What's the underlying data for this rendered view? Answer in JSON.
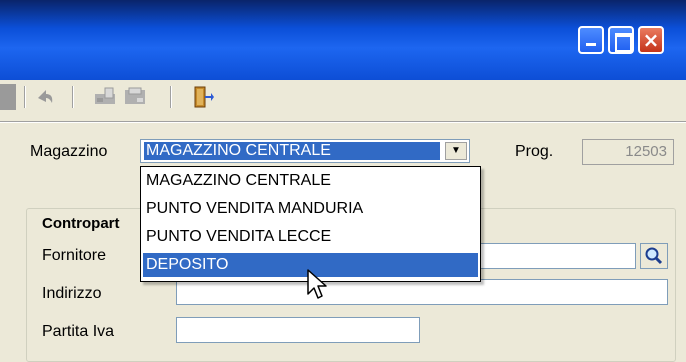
{
  "window": {
    "controls": {
      "minimize": "minimize-icon",
      "maximize": "maximize-icon",
      "close": "close-icon"
    }
  },
  "toolbar": {
    "icons": [
      "delete-icon",
      "undo-icon",
      "print-preview-icon",
      "print-icon",
      "exit-icon"
    ]
  },
  "form": {
    "magazzino_label": "Magazzino",
    "magazzino_value": "MAGAZZINO CENTRALE",
    "prog_label": "Prog.",
    "prog_value": "12503",
    "group_title": "Contropart",
    "fornitore_label": "Fornitore",
    "fornitore_value": "",
    "indirizzo_label": "Indirizzo",
    "indirizzo_value": "",
    "partita_iva_label": "Partita Iva",
    "partita_iva_value": ""
  },
  "dropdown": {
    "options": [
      "MAGAZZINO CENTRALE",
      "PUNTO VENDITA MANDURIA",
      "PUNTO VENDITA LECCE",
      "DEPOSITO"
    ],
    "highlighted_index": 3
  },
  "colors": {
    "selection": "#316ac5",
    "titlebar": "#0b4fd8",
    "window_bg": "#ece9d8"
  }
}
